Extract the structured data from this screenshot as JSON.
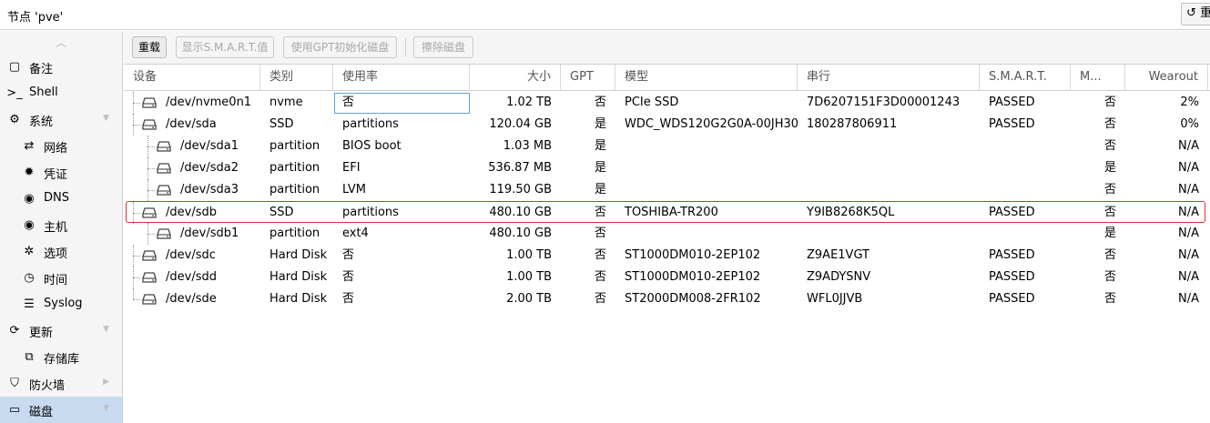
{
  "header": {
    "node_title": "节点 'pve'",
    "reload_button": "重"
  },
  "sidebar": {
    "items": [
      {
        "label": "备注",
        "icon": "notes-icon",
        "glyph": "▢"
      },
      {
        "label": "Shell",
        "icon": "terminal-icon",
        "glyph": ">_"
      },
      {
        "label": "系统",
        "icon": "cogs-icon",
        "glyph": "⚙",
        "expandable": true
      },
      {
        "label": "网络",
        "icon": "network-icon",
        "glyph": "⇄",
        "child": true
      },
      {
        "label": "凭证",
        "icon": "certificate-icon",
        "glyph": "✹",
        "child": true
      },
      {
        "label": "DNS",
        "icon": "globe-icon",
        "glyph": "◉",
        "child": true
      },
      {
        "label": "主机",
        "icon": "host-globe-icon",
        "glyph": "◉",
        "child": true
      },
      {
        "label": "选项",
        "icon": "gear-icon",
        "glyph": "✲",
        "child": true
      },
      {
        "label": "时间",
        "icon": "clock-icon",
        "glyph": "◷",
        "child": true
      },
      {
        "label": "Syslog",
        "icon": "list-icon",
        "glyph": "☰",
        "child": true
      },
      {
        "label": "更新",
        "icon": "refresh-icon",
        "glyph": "⟳",
        "expandable": true
      },
      {
        "label": "存储库",
        "icon": "repository-icon",
        "glyph": "⧉",
        "child": true
      },
      {
        "label": "防火墙",
        "icon": "shield-icon",
        "glyph": "⛉",
        "collapsed": true
      },
      {
        "label": "磁盘",
        "icon": "disk-icon",
        "glyph": "▭",
        "active": true,
        "expandable": true
      }
    ]
  },
  "toolbar": {
    "reload": "重载",
    "show_smart": "显示S.M.A.R.T.值",
    "init_gpt": "使用GPT初始化磁盘",
    "wipe_disk": "擦除磁盘"
  },
  "columns": {
    "device": "设备",
    "type": "类别",
    "usage": "使用率",
    "size": "大小",
    "gpt": "GPT",
    "model": "模型",
    "serial": "串行",
    "smart": "S.M.A.R.T.",
    "mounted": "M...",
    "wearout": "Wearout"
  },
  "rows": [
    {
      "device": "/dev/nvme0n1",
      "type": "nvme",
      "usage": "否",
      "size": "1.02 TB",
      "gpt": "否",
      "model": "PCIe SSD",
      "serial": "7D6207151F3D00001243",
      "smart": "PASSED",
      "mounted": "否",
      "wearout": "2%"
    },
    {
      "device": "/dev/sda",
      "type": "SSD",
      "usage": "partitions",
      "size": "120.04 GB",
      "gpt": "是",
      "model": "WDC_WDS120G2G0A-00JH30",
      "serial": "180287806911",
      "smart": "PASSED",
      "mounted": "否",
      "wearout": "0%"
    },
    {
      "device": "/dev/sda1",
      "type": "partition",
      "usage": "BIOS boot",
      "size": "1.03 MB",
      "gpt": "是",
      "model": "",
      "serial": "",
      "smart": "",
      "mounted": "否",
      "wearout": "N/A"
    },
    {
      "device": "/dev/sda2",
      "type": "partition",
      "usage": "EFI",
      "size": "536.87 MB",
      "gpt": "是",
      "model": "",
      "serial": "",
      "smart": "",
      "mounted": "是",
      "wearout": "N/A"
    },
    {
      "device": "/dev/sda3",
      "type": "partition",
      "usage": "LVM",
      "size": "119.50 GB",
      "gpt": "是",
      "model": "",
      "serial": "",
      "smart": "",
      "mounted": "否",
      "wearout": "N/A"
    },
    {
      "device": "/dev/sdb",
      "type": "SSD",
      "usage": "partitions",
      "size": "480.10 GB",
      "gpt": "否",
      "model": "TOSHIBA-TR200",
      "serial": "Y9IB8268K5QL",
      "smart": "PASSED",
      "mounted": "否",
      "wearout": "N/A"
    },
    {
      "device": "/dev/sdb1",
      "type": "partition",
      "usage": "ext4",
      "size": "480.10 GB",
      "gpt": "否",
      "model": "",
      "serial": "",
      "smart": "",
      "mounted": "是",
      "wearout": "N/A"
    },
    {
      "device": "/dev/sdc",
      "type": "Hard Disk",
      "usage": "否",
      "size": "1.00 TB",
      "gpt": "否",
      "model": "ST1000DM010-2EP102",
      "serial": "Z9AE1VGT",
      "smart": "PASSED",
      "mounted": "否",
      "wearout": "N/A"
    },
    {
      "device": "/dev/sdd",
      "type": "Hard Disk",
      "usage": "否",
      "size": "1.00 TB",
      "gpt": "否",
      "model": "ST1000DM010-2EP102",
      "serial": "Z9ADYSNV",
      "smart": "PASSED",
      "mounted": "否",
      "wearout": "N/A"
    },
    {
      "device": "/dev/sde",
      "type": "Hard Disk",
      "usage": "否",
      "size": "2.00 TB",
      "gpt": "否",
      "model": "ST2000DM008-2FR102",
      "serial": "WFL0JJVB",
      "smart": "PASSED",
      "mounted": "否",
      "wearout": "N/A"
    }
  ],
  "colors": {
    "selected_nav": "#c7daf0",
    "highlight_border": "#e03030",
    "edit_border": "#5fa2dd"
  }
}
